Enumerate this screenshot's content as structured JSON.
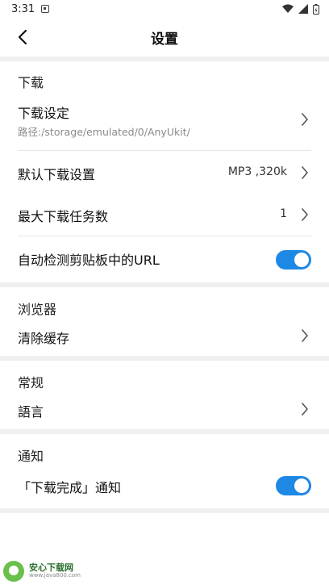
{
  "status_bar": {
    "time": "3:31"
  },
  "header": {
    "title": "设置"
  },
  "sections": {
    "download": {
      "title": "下载",
      "download_setting_label": "下载设定",
      "download_path": "路径:/storage/emulated/0/AnyUkit/",
      "default_download_label": "默认下载设置",
      "default_download_value": "MP3 ,320k",
      "max_tasks_label": "最大下载任务数",
      "max_tasks_value": "1",
      "auto_detect_label": "自动检测剪贴板中的URL",
      "auto_detect_on": true
    },
    "browser": {
      "title": "浏览器",
      "clear_cache_label": "清除缓存"
    },
    "general": {
      "title": "常规",
      "language_label": "語言"
    },
    "notification": {
      "title": "通知",
      "download_complete_label": "「下载完成」通知",
      "download_complete_on": true
    }
  },
  "colors": {
    "toggle_on": "#1e88e5",
    "band": "#f0f0f2"
  },
  "watermark": {
    "title": "安心下载网",
    "url": "www.java800.com"
  }
}
